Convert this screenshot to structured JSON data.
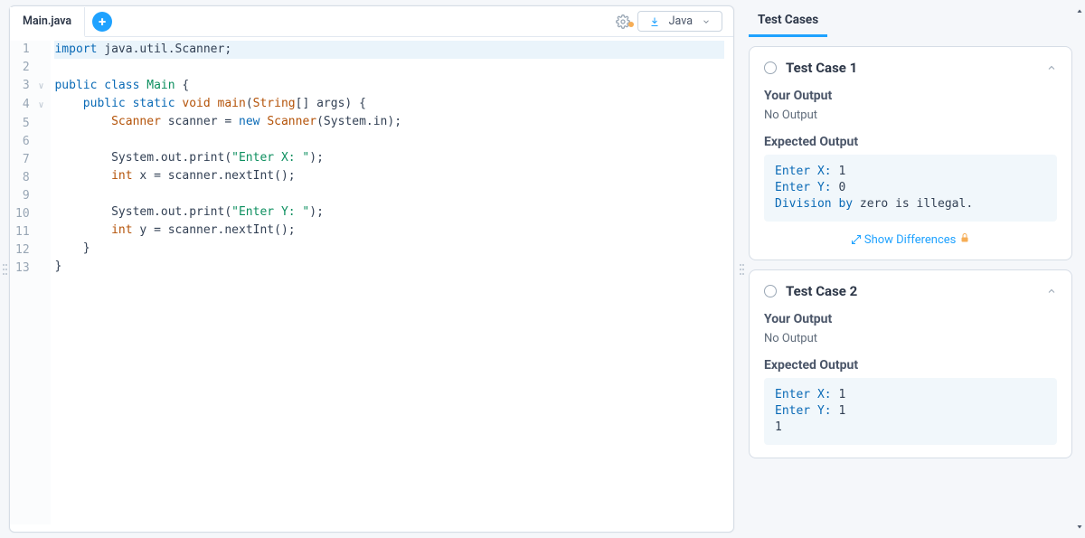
{
  "editor": {
    "tab_name": "Main.java",
    "language": "Java",
    "lines": [
      {
        "n": 1,
        "fold": "",
        "html": "<span class='kw'>import</span> java.util.Scanner;"
      },
      {
        "n": 2,
        "fold": "",
        "html": ""
      },
      {
        "n": 3,
        "fold": "∨",
        "html": "<span class='kw'>public</span> <span class='kw'>class</span> <span class='cls'>Main</span> {"
      },
      {
        "n": 4,
        "fold": "∨",
        "html": "    <span class='kw'>public static</span> <span class='type'>void</span> <span class='fn'>main</span>(<span class='type'>String</span>[] args) {"
      },
      {
        "n": 5,
        "fold": "",
        "html": "        <span class='type'>Scanner</span> scanner = <span class='kw'>new</span> <span class='type'>Scanner</span>(System.in);"
      },
      {
        "n": 6,
        "fold": "",
        "html": ""
      },
      {
        "n": 7,
        "fold": "",
        "html": "        System.out.print(<span class='str'>\"Enter X: \"</span>);"
      },
      {
        "n": 8,
        "fold": "",
        "html": "        <span class='type'>int</span> x = scanner.nextInt();"
      },
      {
        "n": 9,
        "fold": "",
        "html": ""
      },
      {
        "n": 10,
        "fold": "",
        "html": "        System.out.print(<span class='str'>\"Enter Y: \"</span>);"
      },
      {
        "n": 11,
        "fold": "",
        "html": "        <span class='type'>int</span> y = scanner.nextInt();"
      },
      {
        "n": 12,
        "fold": "",
        "html": "    }"
      },
      {
        "n": 13,
        "fold": "",
        "html": "}"
      }
    ]
  },
  "tests": {
    "header": "Test Cases",
    "show_diff": "Show Differences",
    "cases": [
      {
        "name": "Test Case 1",
        "your_output_label": "Your Output",
        "your_output_value": "No Output",
        "expected_label": "Expected Output",
        "expected_lines": [
          "Enter X: 1",
          "Enter Y: 0",
          "Division by zero is illegal."
        ],
        "show_diff": true
      },
      {
        "name": "Test Case 2",
        "your_output_label": "Your Output",
        "your_output_value": "No Output",
        "expected_label": "Expected Output",
        "expected_lines": [
          "Enter X: 1",
          "Enter Y: 1",
          "1"
        ],
        "show_diff": false
      }
    ]
  }
}
